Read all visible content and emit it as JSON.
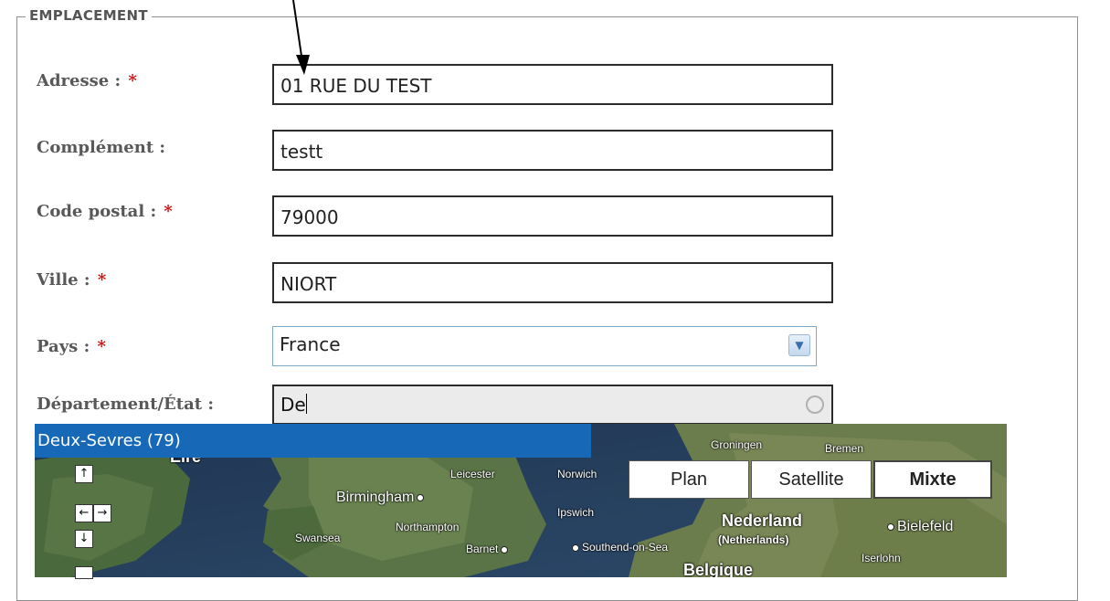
{
  "fieldset": {
    "legend": "EMPLACEMENT"
  },
  "form": {
    "address": {
      "label": "Adresse :",
      "required": "*",
      "value": "01 RUE DU TEST"
    },
    "complement": {
      "label": "Complément :",
      "value": "testt"
    },
    "postal_code": {
      "label": "Code postal :",
      "required": "*",
      "value": "79000"
    },
    "city": {
      "label": "Ville :",
      "required": "*",
      "value": "NIORT"
    },
    "country": {
      "label": "Pays :",
      "required": "*",
      "selected": "France"
    },
    "state": {
      "label": "Département/État :",
      "value": "De"
    }
  },
  "autocomplete": {
    "suggestion": "Deux-Sevres (79)"
  },
  "map": {
    "type_buttons": [
      "Plan",
      "Satellite",
      "Mixte"
    ],
    "active_type": "Mixte",
    "nav": {
      "up": "↑",
      "left": "←",
      "right": "→",
      "down": "↓"
    },
    "labels": {
      "eire": "Eire",
      "birmingham": "Birmingham",
      "leicester": "Leicester",
      "norwich": "Norwich",
      "ipswich": "Ipswich",
      "northampton": "Northampton",
      "swansea": "Swansea",
      "barnet": "Barnet",
      "southend": "Southend-on-Sea",
      "groningen": "Groningen",
      "bremen": "Bremen",
      "nederland": "Nederland",
      "netherlands": "(Netherlands)",
      "bielefeld": "Bielefeld",
      "iserlohn": "Iserlohn",
      "belgique": "Belgique"
    }
  },
  "colors": {
    "suggestion_bg": "#1769b8",
    "required": "#cc1010",
    "label": "#585858"
  }
}
